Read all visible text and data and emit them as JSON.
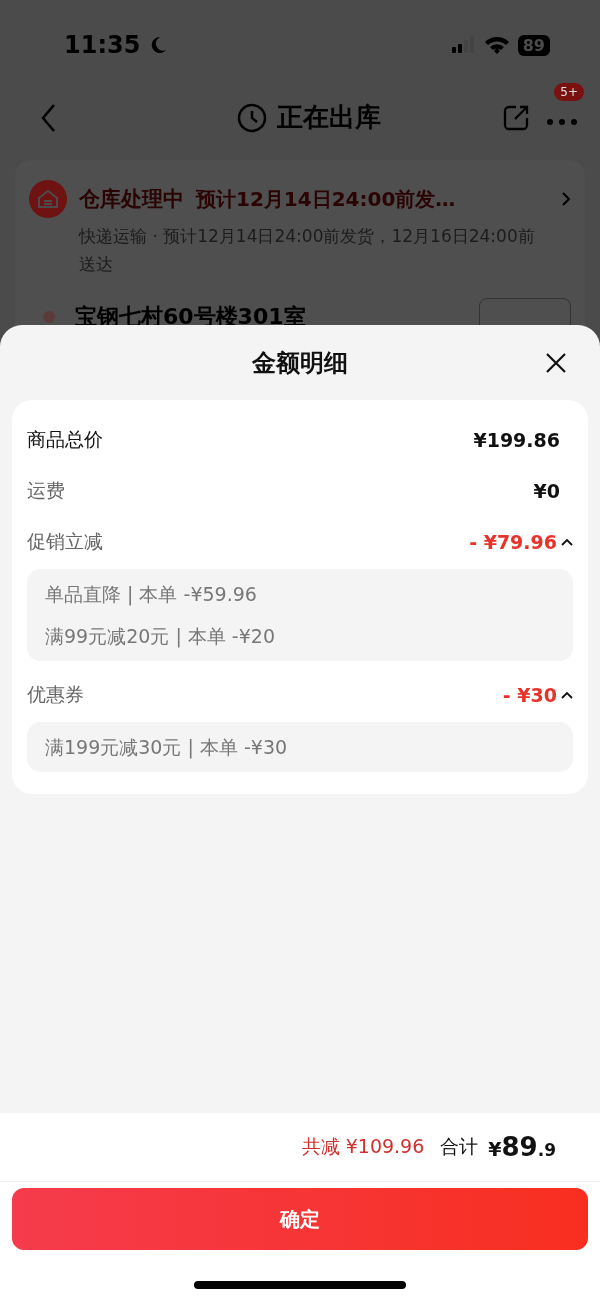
{
  "status_bar": {
    "time": "11:35",
    "battery": "89"
  },
  "nav": {
    "title": "正在出库",
    "badge": "5+"
  },
  "shipment": {
    "status": "仓库处理中",
    "estimate": "预计12月14日24:00前发…",
    "detail": "快递运输 · 预计12月14日24:00前发货，12月16日24:00前送达",
    "address": "宝钢七村60号楼301室"
  },
  "sheet": {
    "title": "金额明细",
    "rows": [
      {
        "kind": "plain",
        "label": "商品总价",
        "amount": "¥199.86",
        "emphasis": true
      },
      {
        "kind": "plain",
        "label": "运费",
        "amount": "¥0",
        "emphasis": false
      },
      {
        "kind": "discount",
        "label": "促销立减",
        "amount": "- ¥79.96",
        "expanded": true,
        "details": [
          "单品直降 | 本单 -¥59.96",
          "满99元减20元 | 本单 -¥20"
        ]
      },
      {
        "kind": "discount",
        "label": "优惠券",
        "amount": "- ¥30",
        "expanded": true,
        "details": [
          "满199元减30元 | 本单 -¥30"
        ]
      }
    ]
  },
  "footer": {
    "saved": "共减 ¥109.96",
    "total_label": "合计",
    "currency": "¥",
    "total_int": "89",
    "total_frac": ".9",
    "confirm": "确定"
  }
}
